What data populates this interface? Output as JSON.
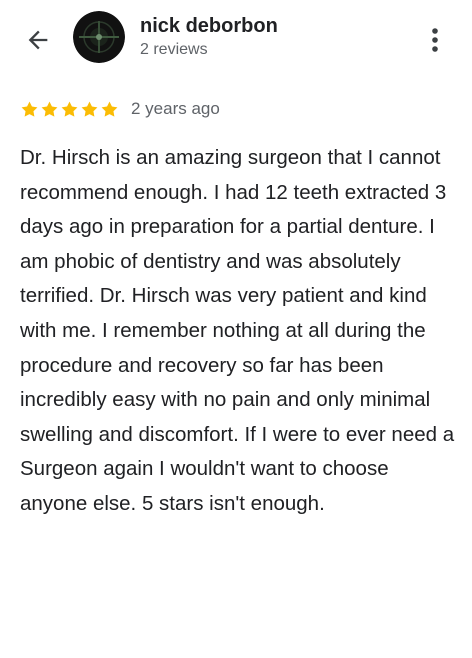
{
  "header": {
    "back_icon": "arrow-back-icon",
    "avatar_icon": "profile-avatar",
    "name": "nick deborbon",
    "reviews_count": "2 reviews",
    "more_icon": "more-vertical-icon"
  },
  "rating": {
    "stars": 5,
    "max_stars": 5,
    "star_color": "#fbbc04",
    "time_ago": "2 years ago"
  },
  "review": {
    "text": "Dr. Hirsch is an amazing surgeon that I cannot recommend enough. I had 12 teeth extracted 3 days ago in preparation for a partial denture. I am phobic of dentistry and was absolutely terrified. Dr. Hirsch was very patient and kind with me. I remember nothing at all during the procedure and recovery so far has been incredibly easy with no pain and only minimal swelling and discomfort. If I were to ever need a Surgeon again I wouldn't want to choose anyone else. 5 stars isn't enough."
  }
}
